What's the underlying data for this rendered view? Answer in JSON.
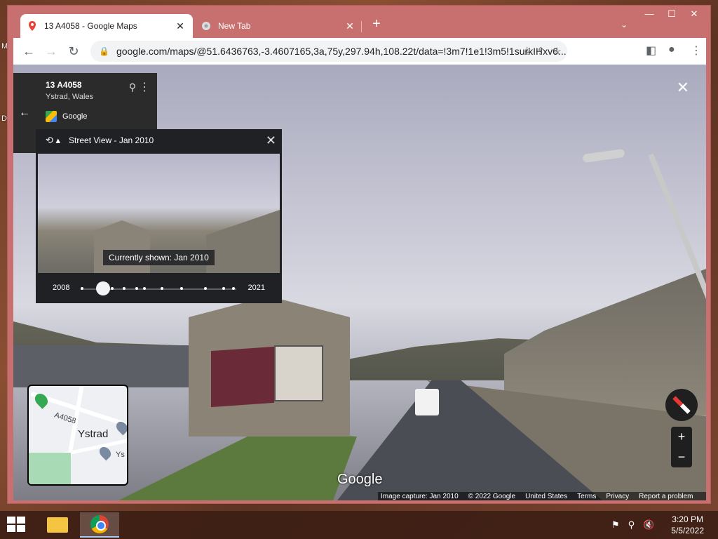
{
  "desktop": {
    "icon_labels": [
      "M",
      "D"
    ]
  },
  "browser": {
    "tabs": [
      {
        "title": "13 A4058 - Google Maps",
        "close": "✕",
        "active": true
      },
      {
        "title": "New Tab",
        "close": "✕",
        "active": false
      }
    ],
    "new_tab": "+",
    "tab_search": "⌄",
    "window_controls": {
      "minimize": "—",
      "maximize": "☐",
      "close": "✕"
    },
    "nav": {
      "back": "←",
      "forward": "→",
      "reload": "↻"
    },
    "omnibox": {
      "lock": "🔒",
      "url": "google.com/maps/@51.6436763,-3.4607165,3a,75y,297.94h,108.22t/data=!3m7!1e1!3m5!1surkIHxv6..."
    },
    "omnibox_icons": {
      "install": "⤓",
      "share": "⇪",
      "bookmark": "☆"
    },
    "toolbar_right": {
      "sidepanel": "◧",
      "profile": "●",
      "menu": "⋮"
    }
  },
  "maps": {
    "back_arrow": "←",
    "place": {
      "title": "13 A4058",
      "subtitle": "Ystrad, Wales",
      "provider": "Google"
    },
    "place_icons": {
      "pin": "⚲",
      "more": "⋮"
    },
    "time_machine": {
      "header": "Street View - Jan 2010",
      "history_icon": "⟲ ▴",
      "close": "✕",
      "caption": "Currently shown: Jan 2010",
      "year_start": "2008",
      "year_end": "2021",
      "selected_index": 0
    },
    "close_streetview": "✕",
    "minimap": {
      "road": "A4058",
      "town": "Ystrad",
      "edge_label": "Ys"
    },
    "zoom": {
      "in": "+",
      "out": "−"
    },
    "watermark": "Google",
    "footer": [
      "Image capture: Jan 2010",
      "© 2022 Google",
      "United States",
      "Terms",
      "Privacy",
      "Report a problem"
    ]
  },
  "taskbar": {
    "tray_icons": [
      "⚑",
      "⚲",
      "🔇"
    ],
    "time": "3:20 PM",
    "date": "5/5/2022"
  }
}
